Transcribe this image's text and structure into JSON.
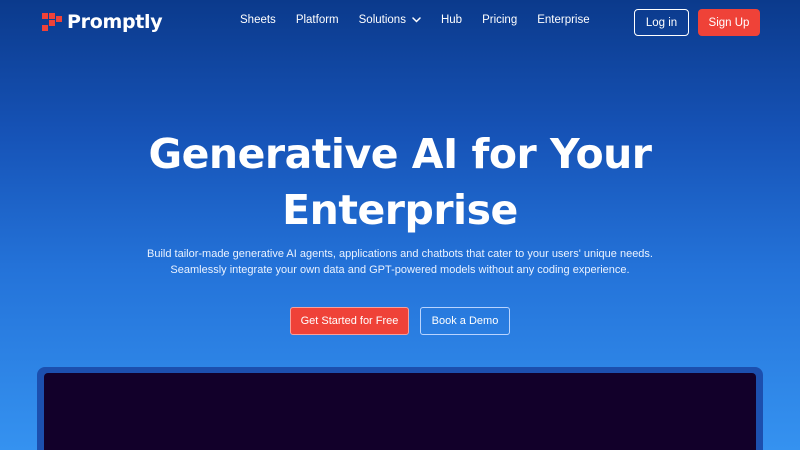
{
  "brand": {
    "name": "Promptly",
    "logo_icon": "promptly-logo-icon",
    "accent_color": "#ef4238"
  },
  "nav": {
    "items": [
      {
        "label": "Sheets"
      },
      {
        "label": "Platform"
      },
      {
        "label": "Solutions",
        "icon": "chevron-down-icon"
      },
      {
        "label": "Hub"
      },
      {
        "label": "Pricing"
      },
      {
        "label": "Enterprise"
      }
    ],
    "login_label": "Log in",
    "signup_label": "Sign Up"
  },
  "hero": {
    "title_line1": "Generative AI for Your",
    "title_line2": "Enterprise",
    "subtitle_line1": "Build tailor-made generative AI agents, applications and chatbots that cater to your users' unique needs.",
    "subtitle_line2": "Seamlessly integrate your own data and GPT-powered models without any coding experience.",
    "primary_cta": "Get Started for Free",
    "secondary_cta": "Book a Demo"
  }
}
